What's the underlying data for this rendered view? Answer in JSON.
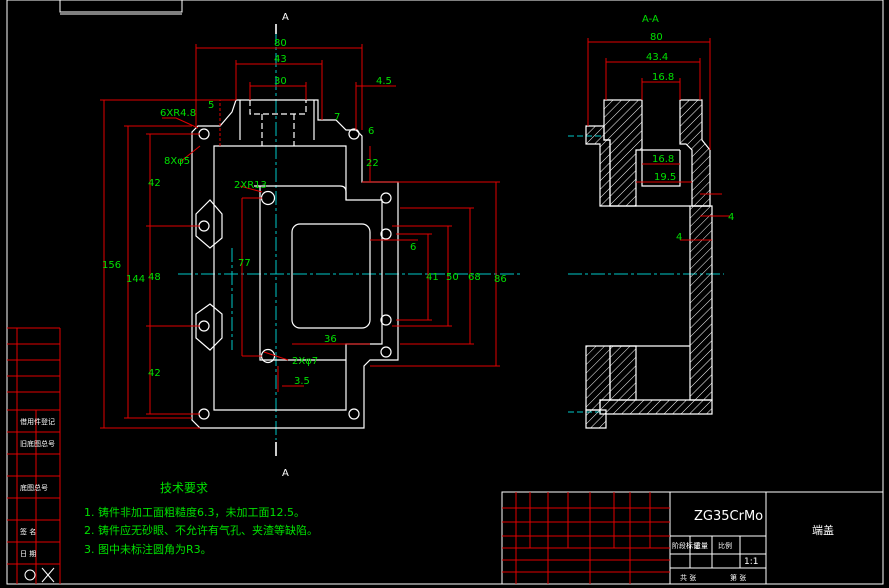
{
  "drawing": {
    "section_label_top": "A",
    "section_label_bottom": "A",
    "section_view_title": "A-A"
  },
  "front_view": {
    "dims": {
      "w80": "80",
      "w43": "43",
      "w30": "30",
      "d4_5": "4.5",
      "d5": "5",
      "d7": "7",
      "d6": "6",
      "d22": "22",
      "holes_6xr": "6XR4.8",
      "holes_8x": "8Xφ5",
      "r13": "2XR13",
      "h42a": "42",
      "h48": "48",
      "h42b": "42",
      "h144": "144",
      "h156": "156",
      "h77": "77",
      "d6b": "6",
      "h41": "41",
      "h50": "50",
      "h68": "68",
      "h86": "86",
      "w36": "36",
      "holes_2x7": "2Xφ7",
      "d3_5": "3.5"
    }
  },
  "section_view": {
    "dims": {
      "w80": "80",
      "w43_4": "43.4",
      "w16_8a": "16.8",
      "w16_8b": "16.8",
      "w19_5": "19.5",
      "d4a": "4",
      "d4b": "4"
    }
  },
  "tech_requirements": {
    "title": "技术要求",
    "items": [
      "1. 铸件非加工面粗糙度6.3，未加工面12.5。",
      "2. 铸件应无砂眼、不允许有气孔、夹渣等缺陷。",
      "3. 图中未标注圆角为R3。"
    ]
  },
  "title_block": {
    "material": "ZG35CrMo",
    "part_name": "端盖",
    "scale": "1:1",
    "col_stage": "阶段标记",
    "col_weight": "重量",
    "col_ratio": "比例",
    "col_sheets": "共 张",
    "col_sheet": "第 张"
  },
  "left_strip": {
    "labels": [
      "借用件登记",
      "旧底图总号",
      "底图总号",
      "签 名",
      "日 期"
    ]
  }
}
